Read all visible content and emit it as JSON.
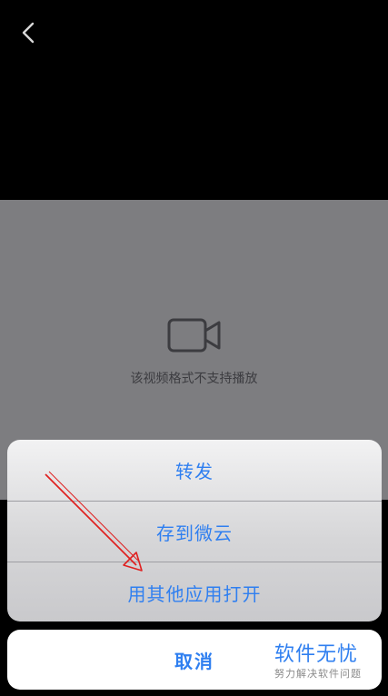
{
  "nav": {
    "back_icon": "chevron-left-icon"
  },
  "video": {
    "icon": "video-camera-icon",
    "message": "该视频格式不支持播放"
  },
  "action_sheet": {
    "items": [
      {
        "label": "转发"
      },
      {
        "label": "存到微云"
      },
      {
        "label": "用其他应用打开"
      }
    ],
    "cancel_label": "取消"
  },
  "watermark": {
    "title": "软件无忧",
    "subtitle": "努力解决软件问题"
  },
  "colors": {
    "accent": "#2f7ff0",
    "annotation": "#e02020"
  }
}
